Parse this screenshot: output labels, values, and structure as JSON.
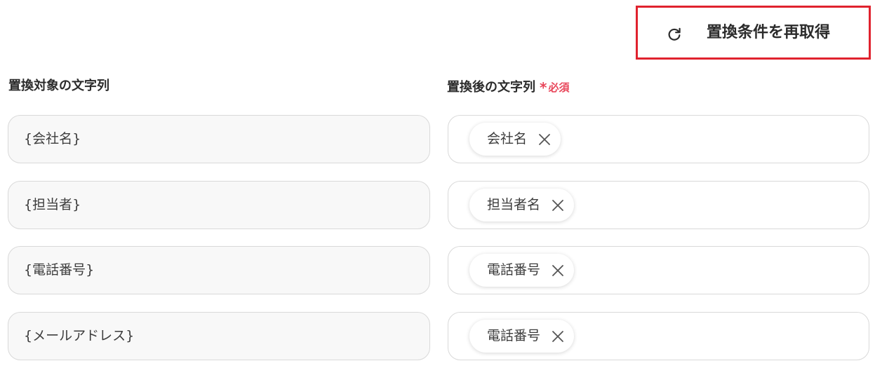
{
  "toolbar": {
    "refresh_label": "置換条件を再取得",
    "refresh_icon": "refresh-icon",
    "highlight_color": "#e0222e"
  },
  "columns": {
    "target_label": "置換対象の文字列",
    "replacement_label": "置換後の文字列",
    "required_mark": "*",
    "required_text": "必須",
    "required_color": "#e8465a"
  },
  "rows": [
    {
      "target": "{会社名}",
      "replacement": "会社名"
    },
    {
      "target": "{担当者}",
      "replacement": "担当者名"
    },
    {
      "target": "{電話番号}",
      "replacement": "電話番号"
    },
    {
      "target": "{メールアドレス}",
      "replacement": "電話番号"
    }
  ],
  "chip_remove_icon": "close-icon"
}
